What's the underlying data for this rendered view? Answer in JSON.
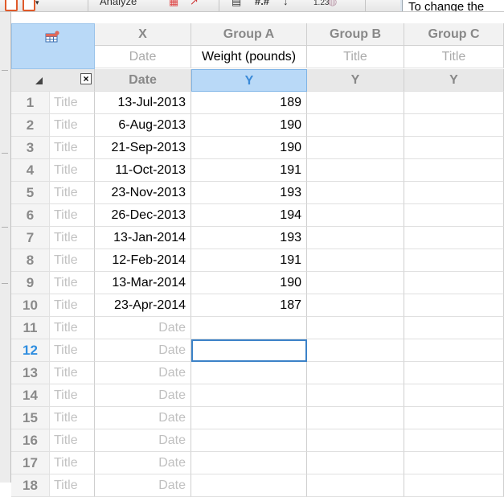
{
  "toolbar": {
    "analyze_label": "Analyze",
    "number_format_label": "#.#",
    "tooltip_text": "To change the"
  },
  "columns": {
    "x": {
      "group": "X",
      "subtitle": "Date",
      "type": "Date"
    },
    "a": {
      "group": "Group A",
      "subtitle": "Weight (pounds)",
      "type": "Y"
    },
    "b": {
      "group": "Group B",
      "subtitle": "Title",
      "type": "Y"
    },
    "c": {
      "group": "Group C",
      "subtitle": "Title",
      "type": "Y"
    }
  },
  "rows": [
    {
      "num": "1",
      "title": "Title",
      "date": "13-Jul-2013",
      "y": "189"
    },
    {
      "num": "2",
      "title": "Title",
      "date": "6-Aug-2013",
      "y": "190"
    },
    {
      "num": "3",
      "title": "Title",
      "date": "21-Sep-2013",
      "y": "190"
    },
    {
      "num": "4",
      "title": "Title",
      "date": "11-Oct-2013",
      "y": "191"
    },
    {
      "num": "5",
      "title": "Title",
      "date": "23-Nov-2013",
      "y": "193"
    },
    {
      "num": "6",
      "title": "Title",
      "date": "26-Dec-2013",
      "y": "194"
    },
    {
      "num": "7",
      "title": "Title",
      "date": "13-Jan-2014",
      "y": "193"
    },
    {
      "num": "8",
      "title": "Title",
      "date": "12-Feb-2014",
      "y": "191"
    },
    {
      "num": "9",
      "title": "Title",
      "date": "13-Mar-2014",
      "y": "190"
    },
    {
      "num": "10",
      "title": "Title",
      "date": "23-Apr-2014",
      "y": "187"
    },
    {
      "num": "11",
      "title": "Title",
      "date": "Date",
      "y": ""
    },
    {
      "num": "12",
      "title": "Title",
      "date": "Date",
      "y": ""
    },
    {
      "num": "13",
      "title": "Title",
      "date": "Date",
      "y": ""
    },
    {
      "num": "14",
      "title": "Title",
      "date": "Date",
      "y": ""
    },
    {
      "num": "15",
      "title": "Title",
      "date": "Date",
      "y": ""
    },
    {
      "num": "16",
      "title": "Title",
      "date": "Date",
      "y": ""
    },
    {
      "num": "17",
      "title": "Title",
      "date": "Date",
      "y": ""
    },
    {
      "num": "18",
      "title": "Title",
      "date": "Date",
      "y": ""
    }
  ],
  "active_row": "12",
  "corner_close_label": "×",
  "colors": {
    "accent": "#2f8ee0",
    "selected_header": "#b9d9f7"
  }
}
